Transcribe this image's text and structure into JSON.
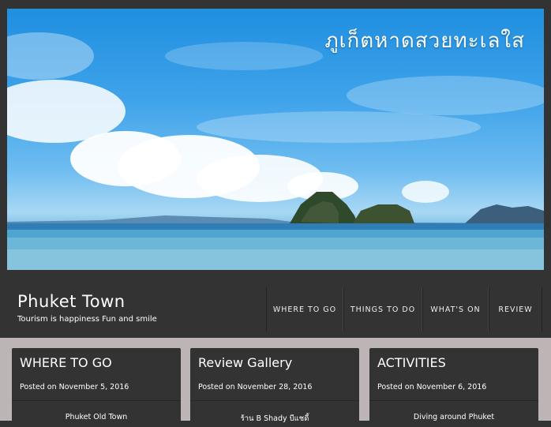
{
  "hero": {
    "caption": "ภูเก็ตหาดสวยทะเลใส"
  },
  "site": {
    "title": "Phuket Town",
    "tagline": "Tourism is happiness Fun and smile"
  },
  "nav": {
    "items": [
      "WHERE TO GO",
      "THINGS TO DO",
      "WHAT'S ON",
      "REVIEW"
    ]
  },
  "cards": [
    {
      "title": "WHERE TO GO",
      "posted_prefix": "Posted on",
      "date": "November 5, 2016",
      "item": "Phuket Old Town"
    },
    {
      "title": "Review Gallery",
      "posted_prefix": "Posted on",
      "date": "November 28, 2016",
      "item": "ร้าน B Shady บีแชดี้"
    },
    {
      "title": "ACTIVITIES",
      "posted_prefix": "Posted on",
      "date": "November 6, 2016",
      "item": "Diving around Phuket"
    }
  ],
  "colors": {
    "background": "#333333",
    "content_area": "#bdb5b5",
    "text": "#ffffff"
  }
}
